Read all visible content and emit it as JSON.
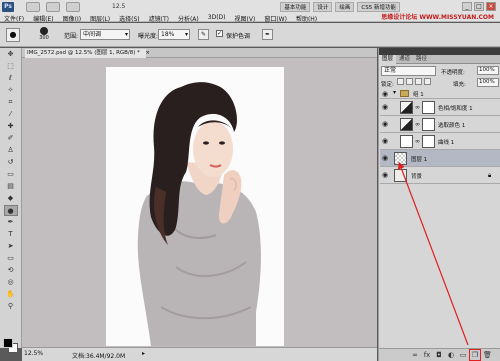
{
  "app": {
    "logo": "Ps",
    "zoom_mini": "12.5",
    "workspace_buttons": [
      "基本功能",
      "设计",
      "绘画"
    ],
    "active_workspace": 0,
    "workspace_extra": "CS5 新增功能",
    "watermark": "思缘设计论坛 WWW.MISSYUAN.COM"
  },
  "menu": [
    "文件(F)",
    "编辑(E)",
    "图像(I)",
    "图层(L)",
    "选择(S)",
    "滤镜(T)",
    "分析(A)",
    "3D(D)",
    "视图(V)",
    "窗口(W)",
    "帮助(H)"
  ],
  "options": {
    "brush_size": "300",
    "range_label": "范围:",
    "range_value": "中间调",
    "exposure_label": "曝光度:",
    "exposure_value": "18%",
    "protect_label": "保护色调",
    "protect_checked": true
  },
  "document": {
    "tab_title": "IMG_2572.psd @ 12.5% (图层 1, RGB/8) *",
    "status_zoom": "12.5%",
    "status_doc": "文档:36.4M/92.0M"
  },
  "layers_panel": {
    "tabs": [
      "图层",
      "通道",
      "路径"
    ],
    "blend_mode": "正常",
    "opacity_label": "不透明度:",
    "opacity_value": "100%",
    "lock_label": "锁定:",
    "fill_label": "填充:",
    "fill_value": "100%",
    "layers": [
      {
        "name": "组 1",
        "kind": "group"
      },
      {
        "name": "色相/饱和度 1",
        "kind": "adjustment"
      },
      {
        "name": "选取颜色 1",
        "kind": "adjustment"
      },
      {
        "name": "曲线 1",
        "kind": "adjustment"
      },
      {
        "name": "图层 1",
        "kind": "pixel",
        "selected": true
      },
      {
        "name": "背景",
        "kind": "background"
      }
    ]
  },
  "icons": {
    "eye": "eye-icon",
    "lock": "lock-icon",
    "new_layer": "new-layer-icon"
  },
  "colors": {
    "annotation": "#e02020",
    "selected_layer": "#b4b8c4",
    "canvas_bg": "#c2bec0"
  }
}
